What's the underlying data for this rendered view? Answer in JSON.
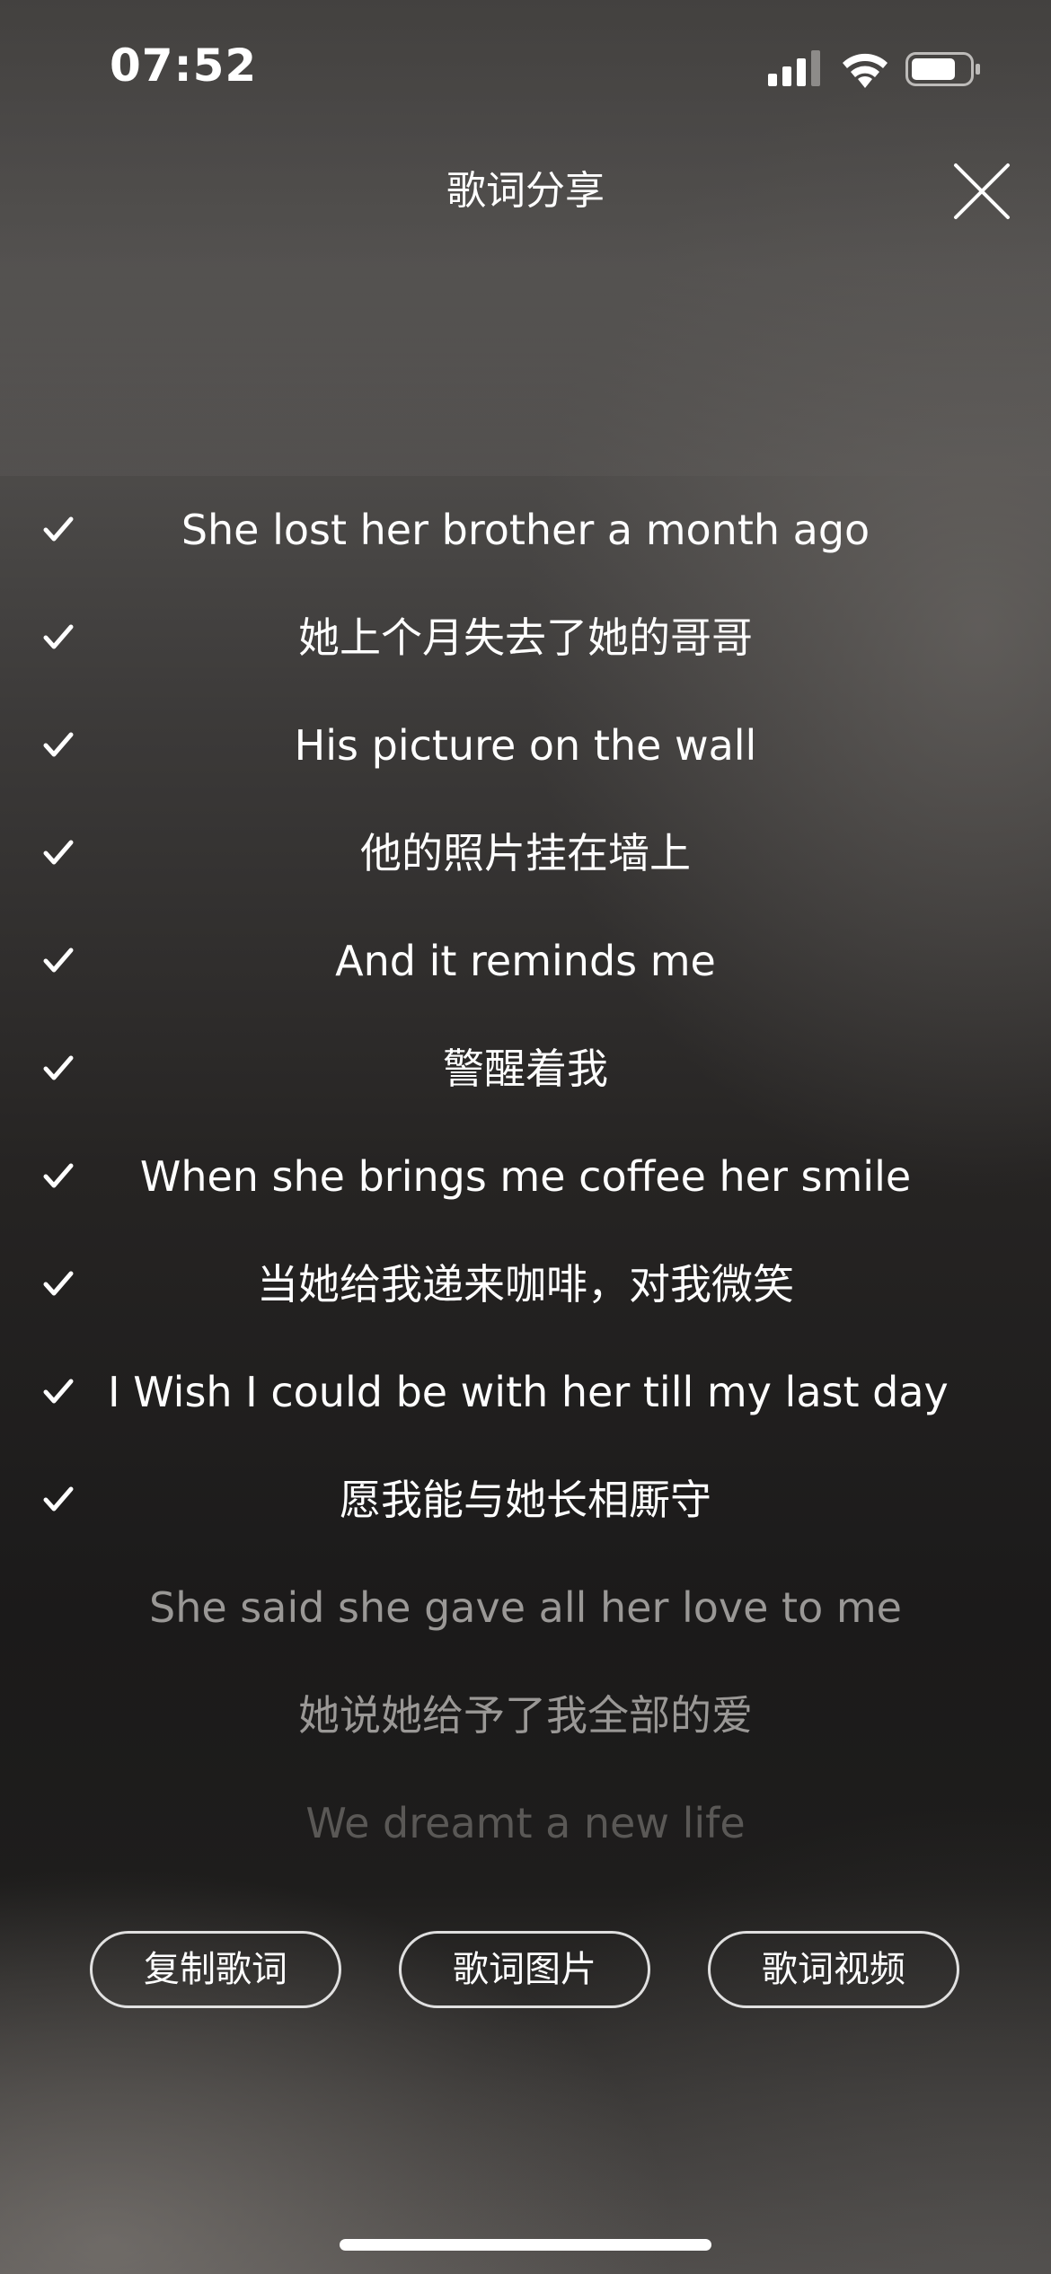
{
  "status_bar": {
    "time": "07:52",
    "icons": [
      "signal-icon",
      "wifi-icon",
      "battery-icon"
    ]
  },
  "header": {
    "title": "歌词分享",
    "close_icon": "close-icon"
  },
  "lyrics": [
    {
      "text": "She lost her brother a month ago",
      "selected": true
    },
    {
      "text": "她上个月失去了她的哥哥",
      "selected": true
    },
    {
      "text": "His picture on the wall",
      "selected": true
    },
    {
      "text": "他的照片挂在墙上",
      "selected": true
    },
    {
      "text": "And it reminds me",
      "selected": true
    },
    {
      "text": "警醒着我",
      "selected": true
    },
    {
      "text": "When she brings me coffee her smile",
      "selected": true
    },
    {
      "text": "当她给我递来咖啡，对我微笑",
      "selected": true
    },
    {
      "text": "I Wish I could be with her till my last day",
      "selected": true
    },
    {
      "text": "愿我能与她长相厮守",
      "selected": true
    },
    {
      "text": "She said she gave all her love to me",
      "selected": false
    },
    {
      "text": "她说她给予了我全部的爱",
      "selected": false
    },
    {
      "text": "We dreamt a new life",
      "selected": false
    }
  ],
  "actions": {
    "copy_lyrics": "复制歌词",
    "lyrics_image": "歌词图片",
    "lyrics_video": "歌词视频"
  },
  "colors": {
    "selected_text": "#ffffff",
    "unselected_text": "#9a9896",
    "faded_text": "#5a5856"
  }
}
